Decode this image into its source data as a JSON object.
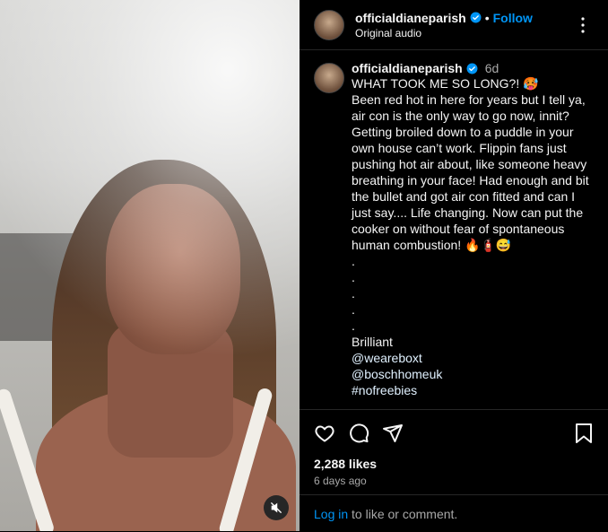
{
  "post": {
    "username": "officialdianeparish",
    "follow_label": "Follow",
    "audio_label": "Original audio",
    "separator": "•"
  },
  "caption": {
    "username": "officialdianeparish",
    "time": "6d",
    "text": "WHAT TOOK ME SO LONG?! 🥵\nBeen red hot in here for years but I tell ya, air con is the only way to go now, innit? Getting broiled down to a puddle in your own house can’t work. Flippin fans just pushing hot air about, like someone heavy breathing in your face! Had enough and bit the bullet and got air con fitted and can I just say.... Life changing. Now can put the cooker on without fear of spontaneous human combustion! 🔥🧯😅\n.\n.\n.\n.\n.\nBrilliant",
    "mentions": [
      "@weareboxt",
      "@boschhomeuk"
    ],
    "hashtag": "#nofreebies"
  },
  "engagement": {
    "likes": "2,288 likes",
    "ago": "6 days ago",
    "login_link": "Log in",
    "login_rest": " to like or comment."
  },
  "icons": [
    "verified-badge-icon",
    "more-options-icon",
    "heart-icon",
    "comment-icon",
    "share-icon",
    "bookmark-icon",
    "mute-icon"
  ],
  "colors": {
    "link_blue": "#0095f6",
    "mention_blue": "#e0f1ff",
    "muted_text": "#a8a8a8",
    "divider": "#262626"
  }
}
